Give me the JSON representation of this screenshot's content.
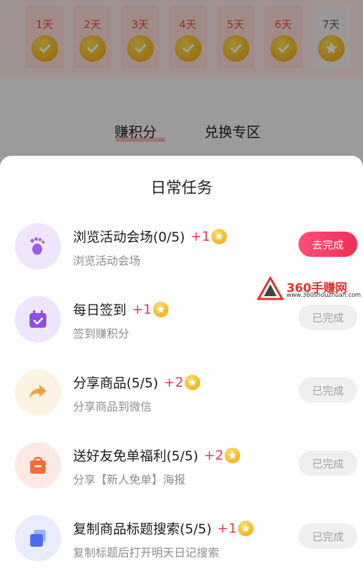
{
  "background": {
    "days": [
      {
        "label": "1天",
        "state": "checked"
      },
      {
        "label": "2天",
        "state": "checked"
      },
      {
        "label": "3天",
        "state": "checked"
      },
      {
        "label": "4天",
        "state": "checked"
      },
      {
        "label": "5天",
        "state": "checked"
      },
      {
        "label": "6天",
        "state": "checked"
      },
      {
        "label": "7天",
        "state": "star"
      }
    ],
    "tabs": {
      "earn": "赚积分",
      "exchange": "兑换专区"
    }
  },
  "sheet": {
    "title": "日常任务",
    "tasks": [
      {
        "title": "浏览活动会场(0/5)",
        "reward": "+1",
        "subtitle": "浏览活动会场",
        "button": "去完成",
        "status": "todo",
        "icon": "footprint-icon",
        "icon_bg": "#efe6fb",
        "icon_color": "#9b5de5"
      },
      {
        "title": "每日签到",
        "reward": "+1",
        "subtitle": "签到赚积分",
        "button": "已完成",
        "status": "done",
        "icon": "calendar-check-icon",
        "icon_bg": "#efe6fb",
        "icon_color": "#8d4fe0"
      },
      {
        "title": "分享商品(5/5)",
        "reward": "+2",
        "subtitle": "分享商品到微信",
        "button": "已完成",
        "status": "done",
        "icon": "share-arrow-icon",
        "icon_bg": "#fdf3e2",
        "icon_color": "#f5a23a"
      },
      {
        "title": "送好友免单福利(5/5)",
        "reward": "+2",
        "subtitle": "分享【新人免单】海报",
        "button": "已完成",
        "status": "done",
        "icon": "gift-bag-icon",
        "icon_bg": "#fde9e4",
        "icon_color": "#f26b3a"
      },
      {
        "title": "复制商品标题搜索(5/5)",
        "reward": "+1",
        "subtitle": "复制标题后打开明天日记搜索",
        "button": "已完成",
        "status": "done",
        "icon": "copy-icon",
        "icon_bg": "#e9ecfb",
        "icon_color": "#4a6cf0"
      }
    ]
  },
  "watermark": {
    "name": "360手赚网",
    "url": "www.360shouzhuan.com"
  },
  "colors": {
    "accent": "#ee2f56",
    "reward": "#e8345a",
    "coin": "#f0b31a"
  }
}
